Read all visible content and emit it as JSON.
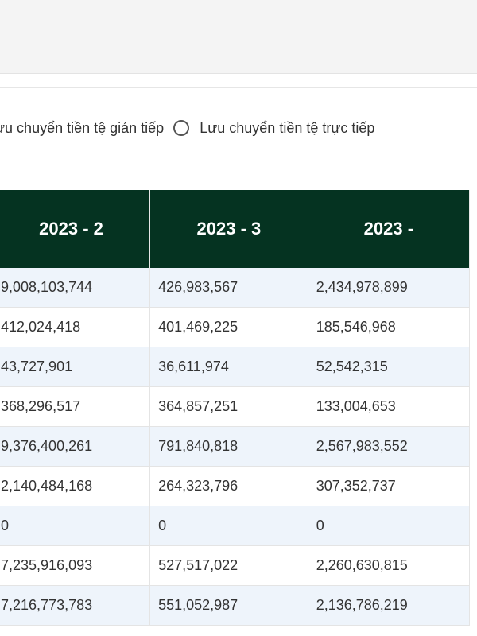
{
  "cashflow_method": {
    "options": [
      {
        "label": "ưu chuyển tiền tệ gián tiếp",
        "selected": true
      },
      {
        "label": "Lưu chuyển tiền tệ trực tiếp",
        "selected": false
      }
    ]
  },
  "table": {
    "columns": [
      "2023 - 2",
      "2023 - 3",
      "2023 -"
    ],
    "rows": [
      [
        "9,008,103,744",
        "426,983,567",
        "2,434,978,899"
      ],
      [
        "412,024,418",
        "401,469,225",
        "185,546,968"
      ],
      [
        "43,727,901",
        "36,611,974",
        "52,542,315"
      ],
      [
        "368,296,517",
        "364,857,251",
        "133,004,653"
      ],
      [
        "9,376,400,261",
        "791,840,818",
        "2,567,983,552"
      ],
      [
        "2,140,484,168",
        "264,323,796",
        "307,352,737"
      ],
      [
        "0",
        "0",
        "0"
      ],
      [
        "7,235,916,093",
        "527,517,022",
        "2,260,630,815"
      ],
      [
        "7,216,773,783",
        "551,052,987",
        "2,136,786,219"
      ]
    ]
  },
  "colors": {
    "header_bg": "#053321",
    "header_text": "#ffffff",
    "row_alt_bg": "#eef4fb"
  }
}
